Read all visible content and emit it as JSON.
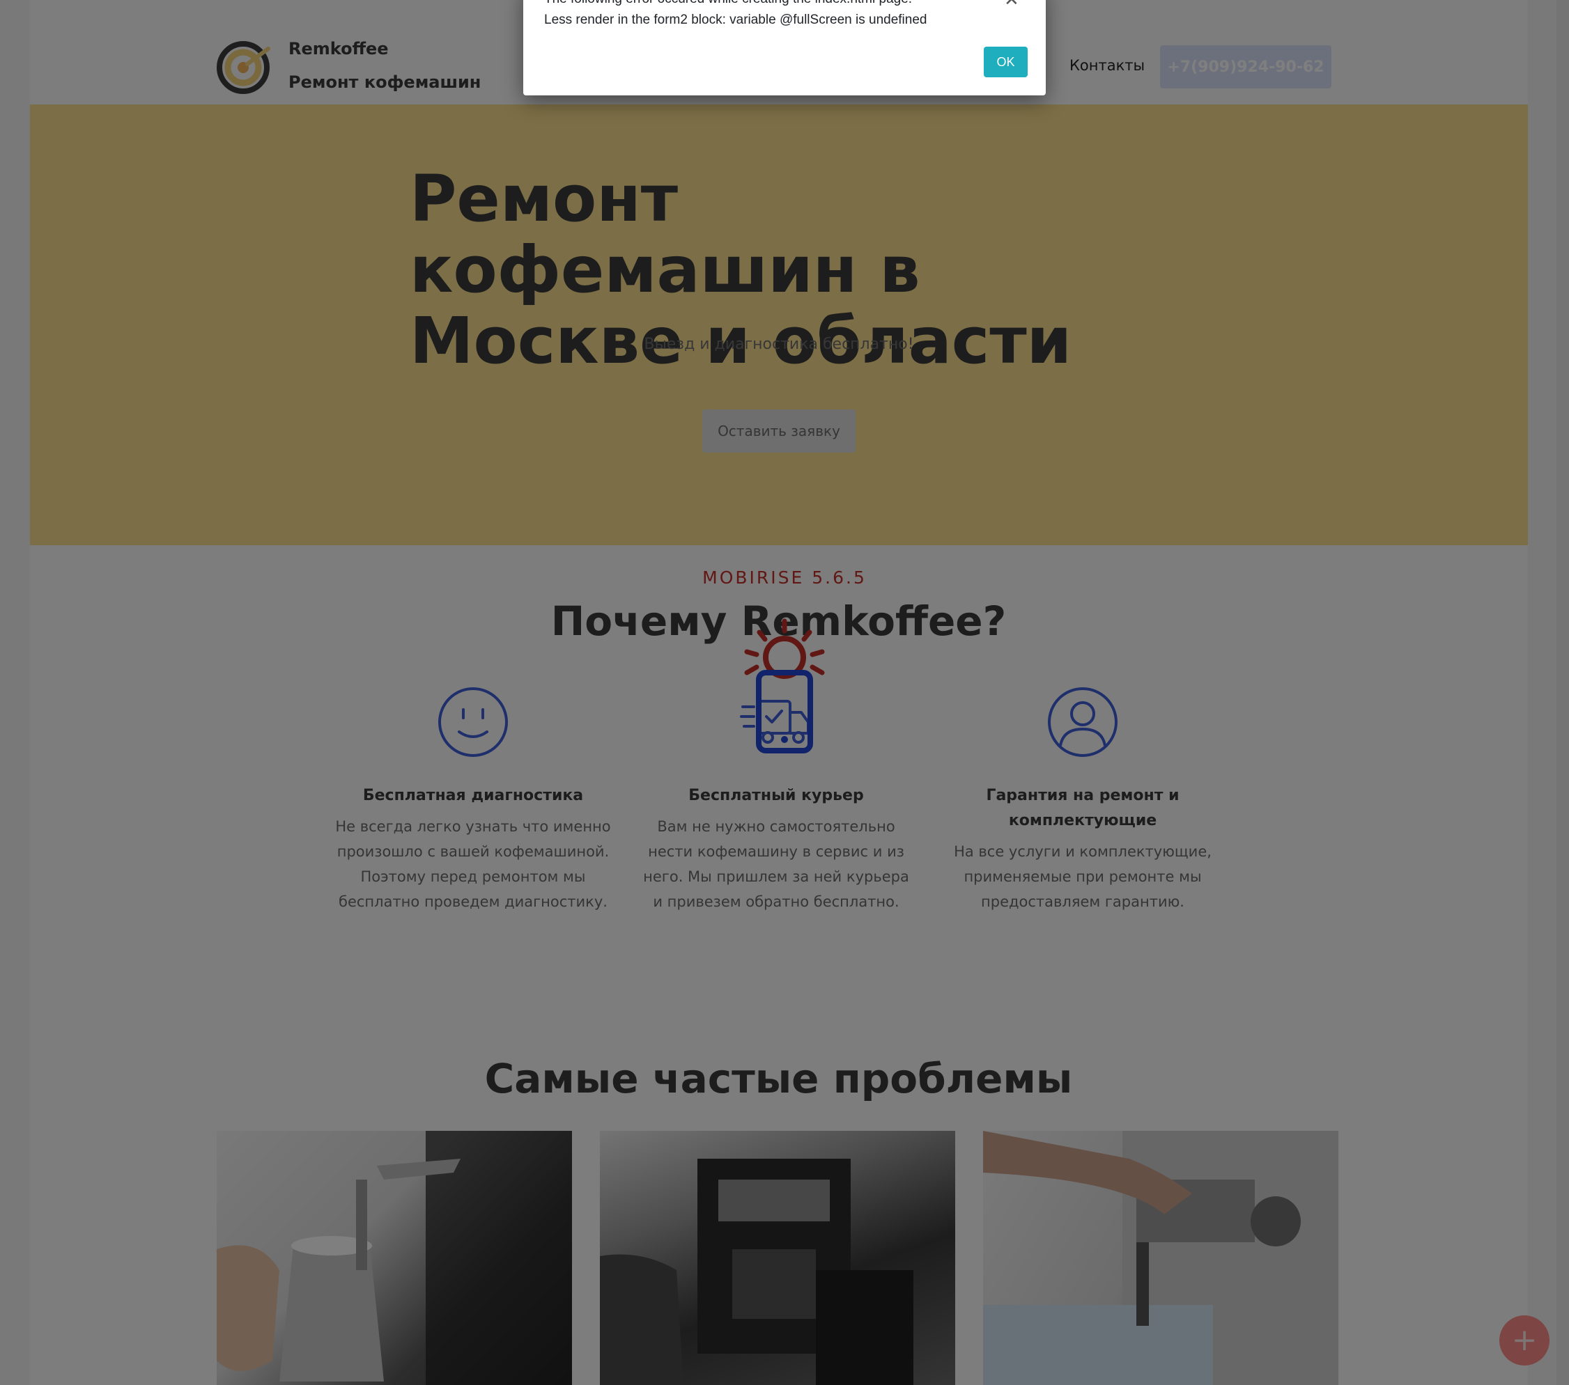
{
  "header": {
    "brand_name": "Remkoffee",
    "brand_sub": "Ремонт кофемашин",
    "nav_contacts": "Контакты",
    "phone": "+7(909)924-90-62"
  },
  "hero": {
    "title": "Ремонт кофемашин в Москве и области",
    "subtitle": "Выезд и диагностика бесплатно!",
    "cta": "Оставить заявку"
  },
  "features": {
    "eyebrow": "MOBIRISE  5.6.5",
    "title": "Почему Remkoffee?",
    "items": [
      {
        "icon": "smile-icon",
        "title": "Бесплатная диагностика",
        "text": "Не всегда легко узнать что именно произошло с вашей кофемашиной. Поэтому перед ремонтом мы бесплатно проведем диагностику."
      },
      {
        "icon": "delivery-truck-icon",
        "title": "Бесплатный курьер",
        "text": "Вам не нужно самостоятельно нести кофемашину в сервис и из него. Мы пришлем за ней курьера и привезем обратно бесплатно."
      },
      {
        "icon": "user-icon",
        "title": "Гарантия на ремонт и комплектующие",
        "text": "На все услуги и комплектующие, применяемые при ремонте мы предоставляем гарантию."
      }
    ]
  },
  "problems": {
    "title": "Самые частые проблемы"
  },
  "fab_icon": "plus-icon",
  "modal": {
    "line1": "The following error occured while creating the index.html page:",
    "line2": "Less render in the form2 block: variable @fullScreen is undefined",
    "ok": "OK"
  },
  "colors": {
    "hero_bg": "#f8dc8c",
    "accent_red": "#c2312b",
    "ok_button": "#1eaebd",
    "phone_button": "#d7e0f8"
  }
}
